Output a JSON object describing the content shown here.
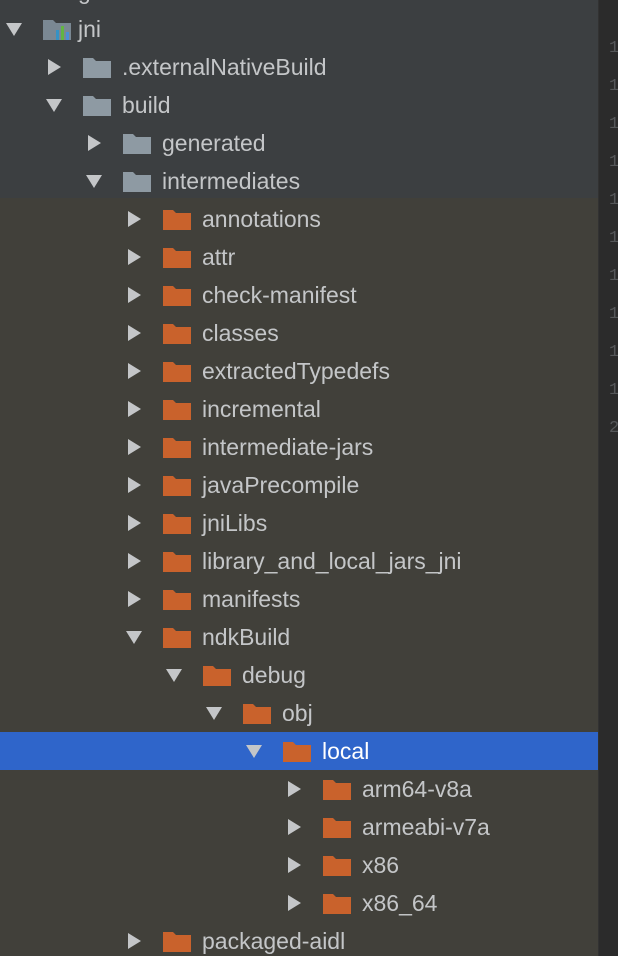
{
  "tree": {
    "top_partial_label": "g",
    "rows": [
      {
        "label": "jni",
        "depth": 0,
        "expanded": true,
        "icon": "module",
        "color": "#7a8893"
      },
      {
        "label": ".externalNativeBuild",
        "depth": 1,
        "expanded": false,
        "icon": "folder",
        "color": "#8e9aa3"
      },
      {
        "label": "build",
        "depth": 1,
        "expanded": true,
        "icon": "folder",
        "color": "#8e9aa3"
      },
      {
        "label": "generated",
        "depth": 2,
        "expanded": false,
        "icon": "folder",
        "color": "#8e9aa3"
      },
      {
        "label": "intermediates",
        "depth": 2,
        "expanded": true,
        "icon": "folder",
        "color": "#8e9aa3"
      },
      {
        "label": "annotations",
        "depth": 3,
        "expanded": false,
        "icon": "folder",
        "color": "#c9622c"
      },
      {
        "label": "attr",
        "depth": 3,
        "expanded": false,
        "icon": "folder",
        "color": "#c9622c"
      },
      {
        "label": "check-manifest",
        "depth": 3,
        "expanded": false,
        "icon": "folder",
        "color": "#c9622c"
      },
      {
        "label": "classes",
        "depth": 3,
        "expanded": false,
        "icon": "folder",
        "color": "#c9622c"
      },
      {
        "label": "extractedTypedefs",
        "depth": 3,
        "expanded": false,
        "icon": "folder",
        "color": "#c9622c"
      },
      {
        "label": "incremental",
        "depth": 3,
        "expanded": false,
        "icon": "folder",
        "color": "#c9622c"
      },
      {
        "label": "intermediate-jars",
        "depth": 3,
        "expanded": false,
        "icon": "folder",
        "color": "#c9622c"
      },
      {
        "label": "javaPrecompile",
        "depth": 3,
        "expanded": false,
        "icon": "folder",
        "color": "#c9622c"
      },
      {
        "label": "jniLibs",
        "depth": 3,
        "expanded": false,
        "icon": "folder",
        "color": "#c9622c"
      },
      {
        "label": "library_and_local_jars_jni",
        "depth": 3,
        "expanded": false,
        "icon": "folder",
        "color": "#c9622c"
      },
      {
        "label": "manifests",
        "depth": 3,
        "expanded": false,
        "icon": "folder",
        "color": "#c9622c"
      },
      {
        "label": "ndkBuild",
        "depth": 3,
        "expanded": true,
        "icon": "folder",
        "color": "#c9622c"
      },
      {
        "label": "debug",
        "depth": 4,
        "expanded": true,
        "icon": "folder",
        "color": "#c9622c"
      },
      {
        "label": "obj",
        "depth": 5,
        "expanded": true,
        "icon": "folder",
        "color": "#c9622c"
      },
      {
        "label": "local",
        "depth": 6,
        "expanded": true,
        "icon": "folder",
        "color": "#c9622c",
        "selected": true
      },
      {
        "label": "arm64-v8a",
        "depth": 7,
        "expanded": false,
        "icon": "folder",
        "color": "#c9622c"
      },
      {
        "label": "armeabi-v7a",
        "depth": 7,
        "expanded": false,
        "icon": "folder",
        "color": "#c9622c"
      },
      {
        "label": "x86",
        "depth": 7,
        "expanded": false,
        "icon": "folder",
        "color": "#c9622c"
      },
      {
        "label": "x86_64",
        "depth": 7,
        "expanded": false,
        "icon": "folder",
        "color": "#c9622c"
      },
      {
        "label": "packaged-aidl",
        "depth": 3,
        "expanded": false,
        "icon": "folder",
        "color": "#c9622c"
      }
    ]
  },
  "gutter": {
    "line_numbers": [
      "1",
      "1",
      "1",
      "1",
      "1",
      "1",
      "1",
      "1",
      "1",
      "1",
      "2"
    ]
  },
  "colors": {
    "panel_bg": "#3c3f41",
    "selection": "#2f65ca",
    "text": "#c4c6c8",
    "arrow": "#c4c6c8"
  }
}
